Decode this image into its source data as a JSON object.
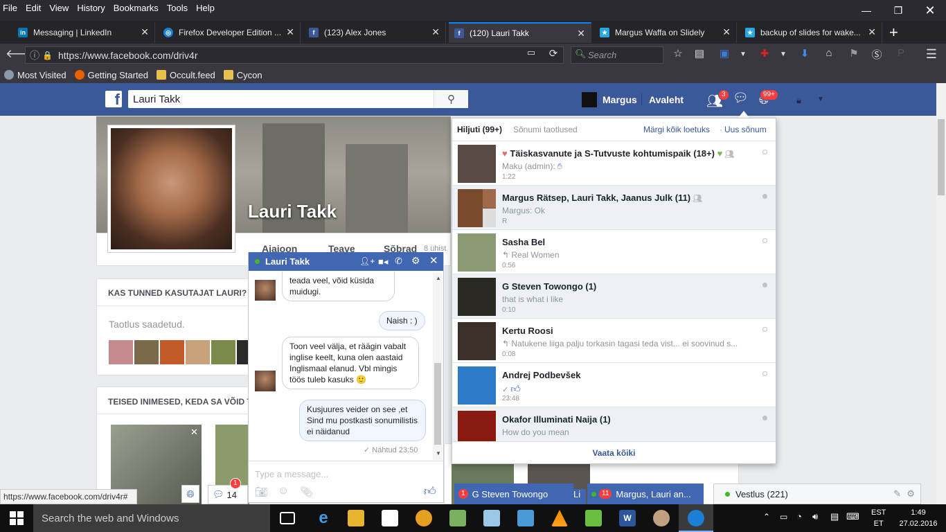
{
  "menubar": {
    "items": [
      "File",
      "Edit",
      "View",
      "History",
      "Bookmarks",
      "Tools",
      "Help"
    ]
  },
  "tabs": [
    {
      "title": "Messaging | LinkedIn",
      "icon": "linkedin-icon",
      "color": "#0077b5",
      "glyph": "in"
    },
    {
      "title": "Firefox Developer Edition ...",
      "icon": "firefox-dev-icon",
      "color": "#1b7fd6",
      "glyph": "◎"
    },
    {
      "title": "(123) Alex Jones",
      "icon": "facebook-icon",
      "color": "#3b5998",
      "glyph": "f"
    },
    {
      "title": "(120) Lauri Takk",
      "icon": "facebook-icon",
      "color": "#3b5998",
      "glyph": "f"
    },
    {
      "title": "Margus Waffa on Slidely",
      "icon": "slidely-icon",
      "color": "#29a8e0",
      "glyph": "★"
    },
    {
      "title": "backup of slides for wake...",
      "icon": "slidely-icon",
      "color": "#29a8e0",
      "glyph": "★"
    }
  ],
  "url": "https://www.facebook.com/driv4r",
  "search_placeholder": "Search",
  "bookmarks": [
    {
      "label": "Most Visited",
      "icon": "gear-icon",
      "color": "#8899aa"
    },
    {
      "label": "Getting Started",
      "icon": "firefox-icon",
      "color": "#e66000"
    },
    {
      "label": "Occult.feed",
      "icon": "folder-icon",
      "color": "#e8c04a"
    },
    {
      "label": "Cycon",
      "icon": "folder-icon",
      "color": "#e8c04a"
    }
  ],
  "fb": {
    "search_value": "Lauri Takk",
    "user": "Margus",
    "home": "Avaleht",
    "friend_badge": "3",
    "notif_badge": "99+"
  },
  "profile": {
    "name": "Lauri Takk",
    "tabs": [
      "Ajajoon",
      "Teave",
      "Sõbrad"
    ],
    "friends_count": "8 ühist",
    "know_title": "KAS TUNNED KASUTAJAT LAURI?",
    "request_sent": "Taotlus saadetud.",
    "others_title": "TEISED INIMESED, KEDA SA VÕID TE"
  },
  "dropdown": {
    "tab_recent": "Hiljuti (99+)",
    "tab_requests": "Sõnumi taotlused",
    "mark_read": "Märgi kõik loetuks",
    "separator": "·",
    "new_message": "Uus sõnum",
    "see_all": "Vaata kõiki",
    "threads": [
      {
        "name": "Täiskasvanute ja S-Tutvuste kohtumispaik (18+)",
        "snippet": "Maku (admin):",
        "time": "1:22",
        "unread": false,
        "thumb": "#5a4a44"
      },
      {
        "name": "Margus Rätsep, Lauri Takk, Jaanus Julk (11)",
        "snippet": "Margus: Ok",
        "time": "R",
        "unread": true,
        "thumb": "#7a4a2c"
      },
      {
        "name": "Sasha Bel",
        "snippet": "Real Women",
        "time": "0:56",
        "unread": false,
        "thumb": "#8b9a72"
      },
      {
        "name": "G Steven Towongo (1)",
        "snippet": "that is what i like",
        "time": "0:10",
        "unread": true,
        "thumb": "#2a2a22"
      },
      {
        "name": "Kertu Roosi",
        "snippet": "Natukene liiga palju torkasin tagasi teda vist... ei soovinud s...",
        "time": "0:08",
        "unread": false,
        "thumb": "#3a3028"
      },
      {
        "name": "Andrej Podbevšek",
        "snippet": "",
        "time": "23:48",
        "unread": false,
        "thumb": "#2d7bc8"
      },
      {
        "name": "Okafor Illuminati Naija (1)",
        "snippet": "How do you mean",
        "time": "",
        "unread": true,
        "thumb": "#8b1a10"
      }
    ]
  },
  "chat": {
    "name": "Lauri Takk",
    "messages": [
      {
        "dir": "in",
        "text": "teada veel, võid küsida muidugi."
      },
      {
        "dir": "out",
        "text": "Naish : )"
      },
      {
        "dir": "in",
        "text": "Toon veel välja, et räägin vabalt inglise keelt, kuna olen aastaid Inglismaal elanud. Vbl mingis töös tuleb kasuks 🙂"
      },
      {
        "dir": "out",
        "text": "Kusjuures veider on see ,et Sind mu postkasti sonumilistis ei näidanud"
      }
    ],
    "seen": "✓ Nähtud 23:50",
    "input_placeholder": "Type a message..."
  },
  "bottom": {
    "status_url": "https://www.facebook.com/driv4r#",
    "notif_count": "14",
    "notif_badge": "1",
    "chat_tab1": {
      "badge": "1",
      "label": "G Steven Towongo"
    },
    "chat_tab2_prefix": "Li",
    "chat_tab2": {
      "badge": "11",
      "label": "Margus, Lauri an..."
    },
    "sidebar_chat": "Vestlus (221)"
  },
  "taskbar": {
    "search_placeholder": "Search the web and Windows",
    "lang1": "EST",
    "lang2": "ET",
    "time": "1:49",
    "date": "27.02.2016"
  }
}
